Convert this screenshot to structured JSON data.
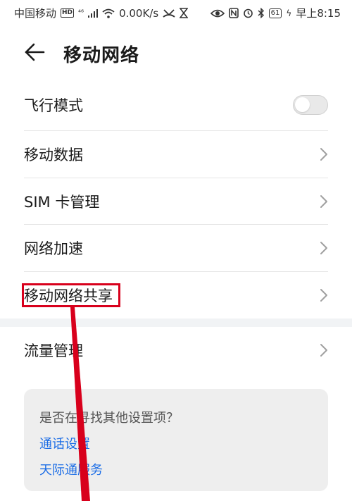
{
  "status_bar": {
    "carrier": "中国移动",
    "hd": "HD",
    "network": "⁴⁶",
    "speed": "0.00K/s",
    "battery": "61",
    "time": "早上8:15"
  },
  "header": {
    "title": "移动网络"
  },
  "settings": [
    {
      "label": "飞行模式",
      "control": "toggle",
      "toggle_on": false
    },
    {
      "label": "移动数据",
      "control": "chevron"
    },
    {
      "label": "SIM 卡管理",
      "control": "chevron"
    },
    {
      "label": "网络加速",
      "control": "chevron"
    },
    {
      "label": "移动网络共享",
      "control": "chevron",
      "highlighted": true
    },
    {
      "label": "流量管理",
      "control": "chevron"
    }
  ],
  "suggestion": {
    "question": "是否在寻找其他设置项？",
    "links": [
      "通话设置",
      "天际通服务"
    ]
  },
  "colors": {
    "highlight": "#d8001c",
    "link": "#1a6ce6",
    "card_bg": "#eeeeee"
  }
}
